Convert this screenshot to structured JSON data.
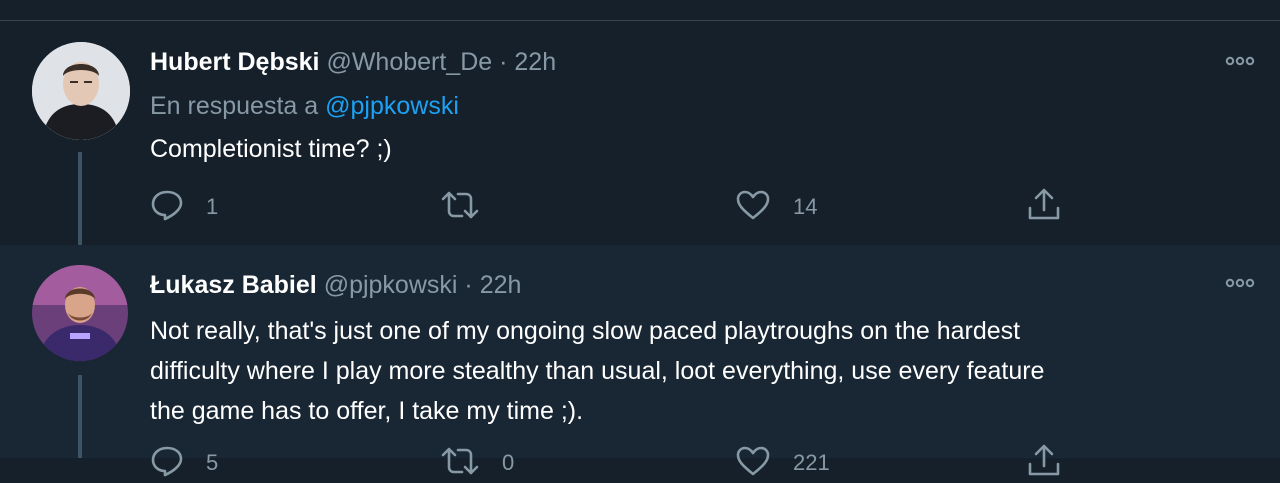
{
  "colors": {
    "background": "#15202b",
    "secondary_text": "#8899a6",
    "link": "#1da1f2"
  },
  "tweets": [
    {
      "author_name": "Hubert Dębski",
      "handle": "@Whobert_De",
      "separator": "·",
      "time": "22h",
      "reply_prefix": "En respuesta a",
      "reply_mention": "@pjpkowski",
      "text": "Completionist time? ;)",
      "reply_count": "1",
      "retweet_count": "",
      "like_count": "14",
      "icons": [
        "avatar",
        "more-icon",
        "reply-icon",
        "retweet-icon",
        "like-icon",
        "share-icon"
      ]
    },
    {
      "author_name": "Łukasz Babiel",
      "handle": "@pjpkowski",
      "separator": "·",
      "time": "22h",
      "text_lines": [
        "Not really, that's just one of my ongoing slow paced playtroughs on the hardest",
        "difficulty where I play more stealthy than usual, loot everything, use every feature",
        "the game has to offer, I take my time ;)."
      ],
      "reply_count": "5",
      "retweet_count": "0",
      "like_count": "221",
      "icons": [
        "avatar",
        "more-icon",
        "reply-icon",
        "retweet-icon",
        "like-icon",
        "share-icon"
      ]
    }
  ]
}
